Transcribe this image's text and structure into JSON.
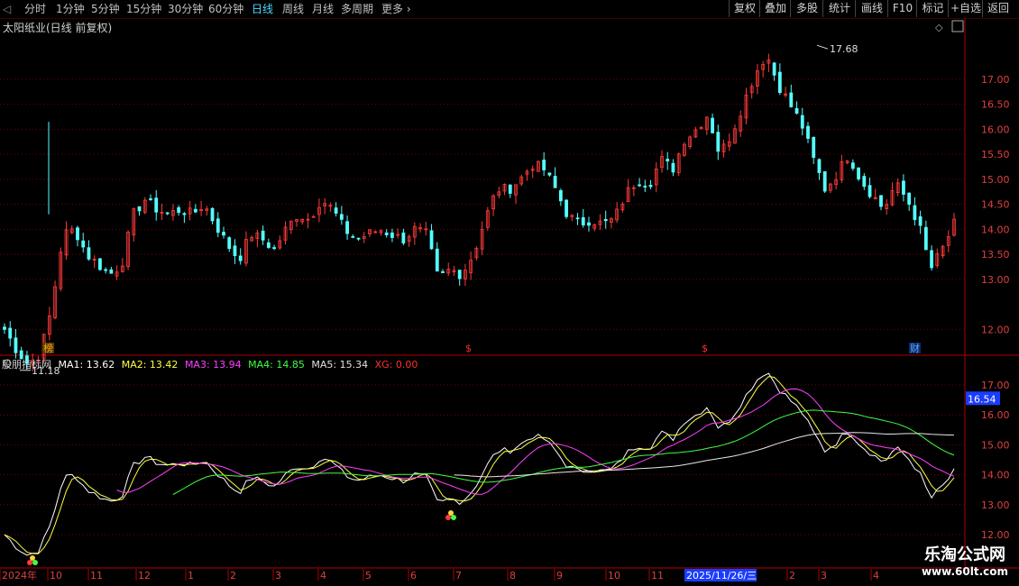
{
  "toolbar": {
    "periods": [
      "分时",
      "1分钟",
      "5分钟",
      "15分钟",
      "30分钟",
      "60分钟",
      "日线",
      "周线",
      "月线",
      "多周期",
      "更多"
    ],
    "active_period": "日线",
    "actions": [
      "复权",
      "叠加",
      "多股",
      "统计",
      "画线",
      "F10",
      "标记",
      "+自选",
      "返回"
    ]
  },
  "title": "太阳纸业(日线 前复权)",
  "price_axis": [
    "17.00",
    "16.50",
    "16.00",
    "15.50",
    "15.00",
    "14.50",
    "14.00",
    "13.50",
    "13.00",
    "12.00"
  ],
  "high_marker": "17.68",
  "low_marker": "11.18",
  "event_markers": [
    {
      "label": "榜",
      "color": "#f5a623"
    },
    {
      "label": "$",
      "color": "#ff3030"
    },
    {
      "label": "$",
      "color": "#ff3030"
    },
    {
      "label": "财",
      "color": "#5aa8ff"
    }
  ],
  "indicator": {
    "name": "股朋指标网",
    "ma1": "MA1: 13.62",
    "ma2": "MA2: 13.42",
    "ma3": "MA3: 13.94",
    "ma4": "MA4: 14.85",
    "ma5": "MA5: 15.34",
    "xg": "XG: 0.00",
    "axis": [
      "17.00",
      "16.00",
      "15.00",
      "14.00",
      "13.00",
      "12.00"
    ],
    "current": "16.54"
  },
  "date_axis": [
    "2024年",
    "10",
    "11",
    "12",
    "1",
    "2",
    "3",
    "4",
    "5",
    "6",
    "7",
    "8",
    "9",
    "10",
    "11",
    "2",
    "3",
    "4"
  ],
  "cursor_date": "2025/11/26/三",
  "colors": {
    "up": "#ff3b3b",
    "down": "#54ffff",
    "ma1": "#ffffff",
    "ma2": "#ffff40",
    "ma3": "#ff40ff",
    "ma4": "#40ff40",
    "ma5": "#ffffff",
    "grid": "#7a0000"
  },
  "chart_data": {
    "type": "candlestick",
    "ylim": [
      11.5,
      17.9
    ],
    "close_series": [
      12.0,
      11.6,
      11.3,
      11.5,
      12.4,
      13.9,
      14.0,
      13.5,
      13.3,
      13.1,
      13.3,
      14.3,
      14.6,
      14.4,
      14.3,
      14.4,
      14.3,
      14.5,
      14.1,
      13.7,
      13.4,
      13.9,
      13.8,
      13.6,
      14.0,
      14.3,
      14.2,
      14.6,
      14.4,
      14.0,
      13.8,
      13.9,
      14.0,
      13.9,
      13.8,
      14.0,
      13.9,
      13.0,
      13.2,
      13.1,
      13.5,
      14.2,
      14.8,
      14.8,
      15.0,
      15.3,
      15.2,
      14.8,
      14.3,
      14.1,
      14.2,
      14.1,
      14.2,
      14.7,
      15.0,
      14.9,
      15.4,
      15.2,
      15.8,
      16.0,
      16.3,
      15.5,
      15.9,
      16.5,
      17.1,
      17.5,
      16.9,
      16.5,
      16.1,
      15.4,
      14.8,
      15.1,
      15.5,
      15.0,
      14.7,
      14.4,
      14.9,
      14.6,
      14.1,
      13.2,
      13.6,
      14.1
    ]
  }
}
